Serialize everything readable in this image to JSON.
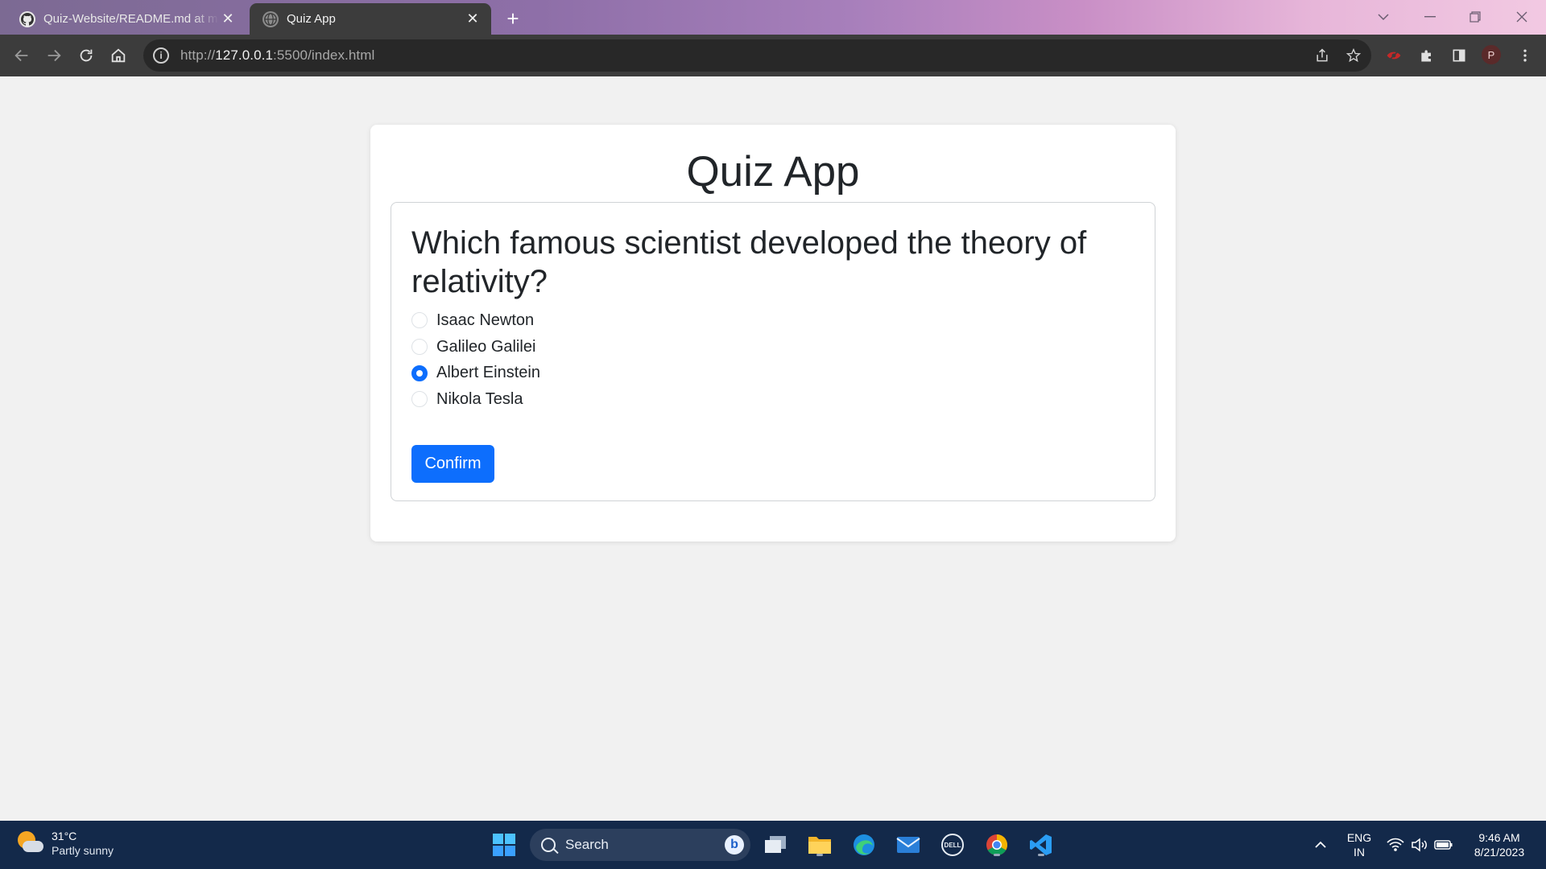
{
  "browser": {
    "tabs": [
      {
        "title": "Quiz-Website/README.md at main",
        "active": false,
        "icon": "github-icon"
      },
      {
        "title": "Quiz App",
        "active": true,
        "icon": "globe-icon"
      }
    ],
    "url_scheme": "http://",
    "url_host": "127.0.0.1",
    "url_rest": ":5500/index.html"
  },
  "profile": {
    "initial": "P"
  },
  "page": {
    "title": "Quiz App",
    "question": "Which famous scientist developed the theory of relativity?",
    "options": [
      {
        "label": "Isaac Newton",
        "checked": false
      },
      {
        "label": "Galileo Galilei",
        "checked": false
      },
      {
        "label": "Albert Einstein",
        "checked": true
      },
      {
        "label": "Nikola Tesla",
        "checked": false
      }
    ],
    "confirm_label": "Confirm",
    "accent_color": "#0d6efd"
  },
  "taskbar": {
    "weather_temp": "31°C",
    "weather_condition": "Partly sunny",
    "search_placeholder": "Search",
    "language": "ENG",
    "region": "IN",
    "time": "9:46 AM",
    "date": "8/21/2023"
  }
}
